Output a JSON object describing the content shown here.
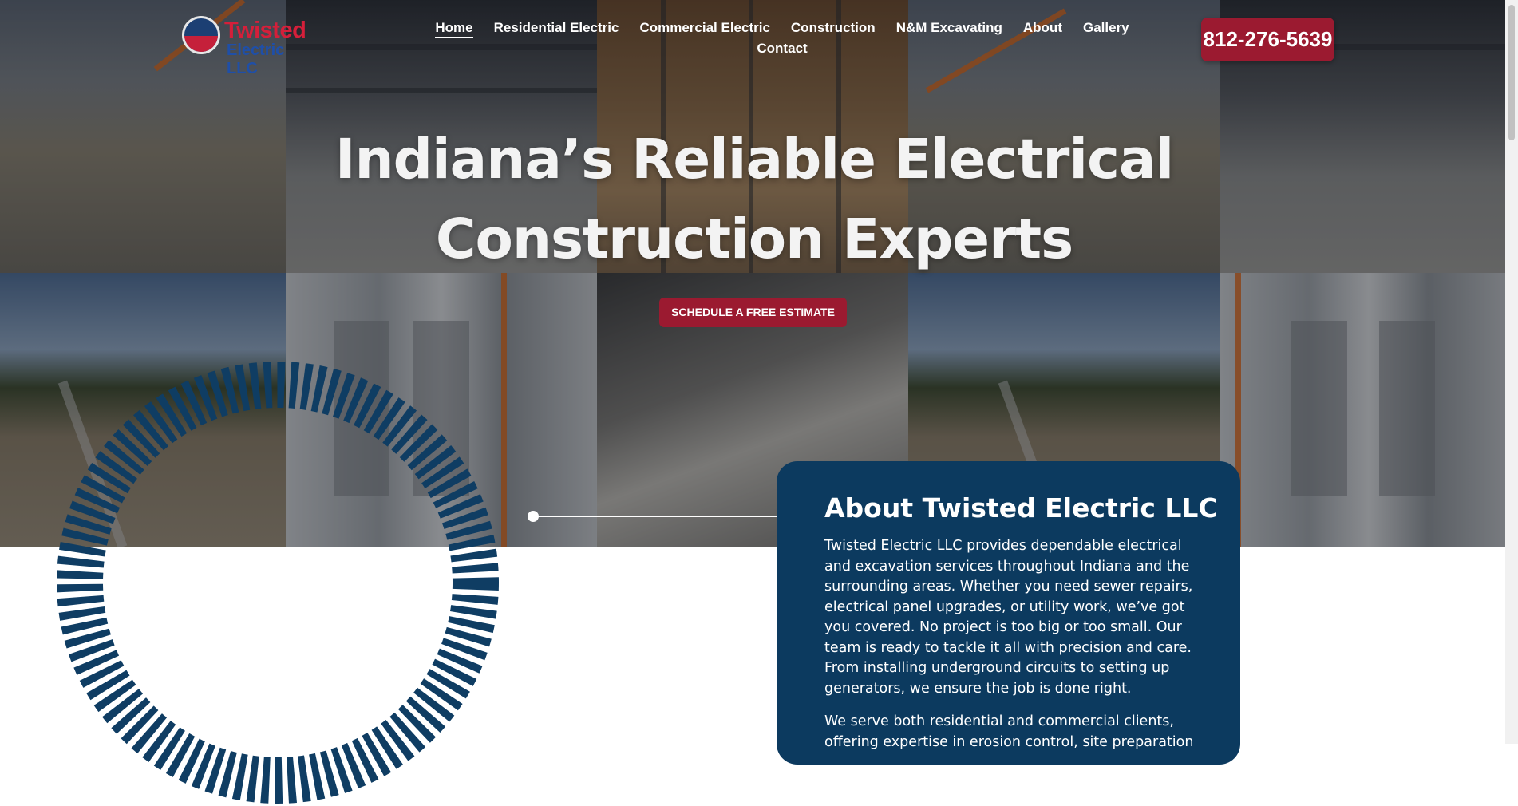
{
  "brand": {
    "logo_line1": "Twisted",
    "logo_line2": "Electric LLC",
    "logo_colors": {
      "primary": "#d51f3a",
      "secondary": "#1f4fa8"
    }
  },
  "nav": {
    "items": [
      {
        "label": "Home",
        "active": true
      },
      {
        "label": "Residential Electric",
        "active": false
      },
      {
        "label": "Commercial Electric",
        "active": false
      },
      {
        "label": "Construction",
        "active": false
      },
      {
        "label": "N&M Excavating",
        "active": false
      },
      {
        "label": "About",
        "active": false
      },
      {
        "label": "Gallery",
        "active": false
      },
      {
        "label": "Contact",
        "active": false
      }
    ]
  },
  "phone": {
    "label": "812-276-5639"
  },
  "hero": {
    "headline_line1": "Indiana’s Reliable Electrical",
    "headline_line2": "Construction Experts",
    "cta_label": "SCHEDULE A FREE ESTIMATE"
  },
  "about": {
    "title": "About Twisted Electric LLC",
    "paragraph1": "Twisted Electric LLC provides dependable electrical and excavation services throughout Indiana and the surrounding areas. Whether you need sewer repairs, electrical panel upgrades, or utility work, we’ve got you covered. No project is too big or too small. Our team is ready to tackle it all with precision and care. From installing underground circuits to setting up generators, we ensure the job is done right.",
    "paragraph2": "We serve both residential and commercial clients, offering expertise in erosion control, site preparation"
  },
  "colors": {
    "accent_red": "#9b1a30",
    "navy": "#0c3a5f",
    "ring_blue": "#0f3d63"
  }
}
